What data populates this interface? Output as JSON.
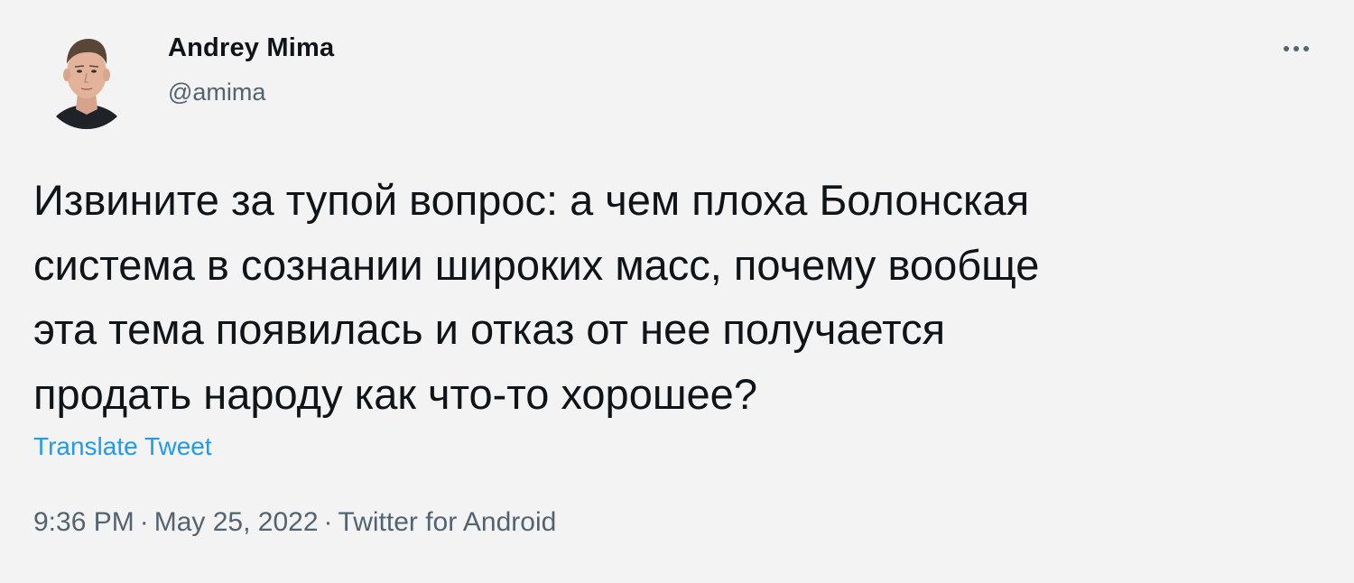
{
  "author": {
    "display_name": "Andrey Mima",
    "handle": "@amima"
  },
  "tweet": {
    "text": "Извините за тупой вопрос: а чем плоха Болонская\nсистема в сознании широких масс, почему вообще\nэта тема появилась и отказ от нее получается\nпродать народу как что-то хорошее?",
    "translate_label": "Translate Tweet",
    "time": "9:36 PM",
    "date": "May 25, 2022",
    "source": "Twitter for Android",
    "separator": "·"
  },
  "icons": {
    "more": "more-horizontal-icon",
    "avatar": "profile-photo"
  },
  "colors": {
    "background": "#f3f3f3",
    "text_primary": "#0f1419",
    "text_secondary": "#536471",
    "link": "#1d9bf0"
  }
}
